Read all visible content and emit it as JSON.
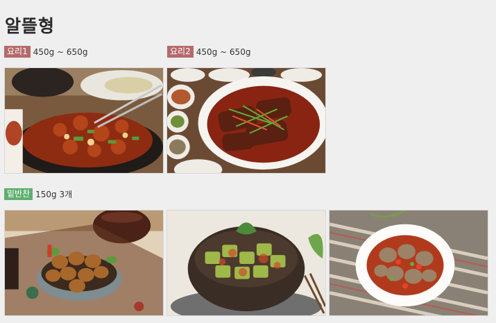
{
  "section": {
    "title": "알뜰형"
  },
  "dishes": [
    {
      "badge": "요리1",
      "weight": "450g ~ 650g",
      "image_desc": "spicy stir-fried pork on a sizzling black plate with chopsticks",
      "badge_color": "#b56a6a"
    },
    {
      "badge": "요리2",
      "weight": "450g ~ 650g",
      "image_desc": "braised galbi in red sauce on a white plate with side dishes",
      "badge_color": "#b56a6a"
    }
  ],
  "side_dishes": {
    "badge": "밑반찬",
    "info": "150g 3개",
    "badge_color": "#5fae6f",
    "images": [
      {
        "image_desc": "soy-braised quail eggs in a grey bowl"
      },
      {
        "image_desc": "seasoned cucumber / zucchini salad in a dark bowl"
      },
      {
        "image_desc": "spicy seasoned clams in a white bowl"
      }
    ]
  }
}
